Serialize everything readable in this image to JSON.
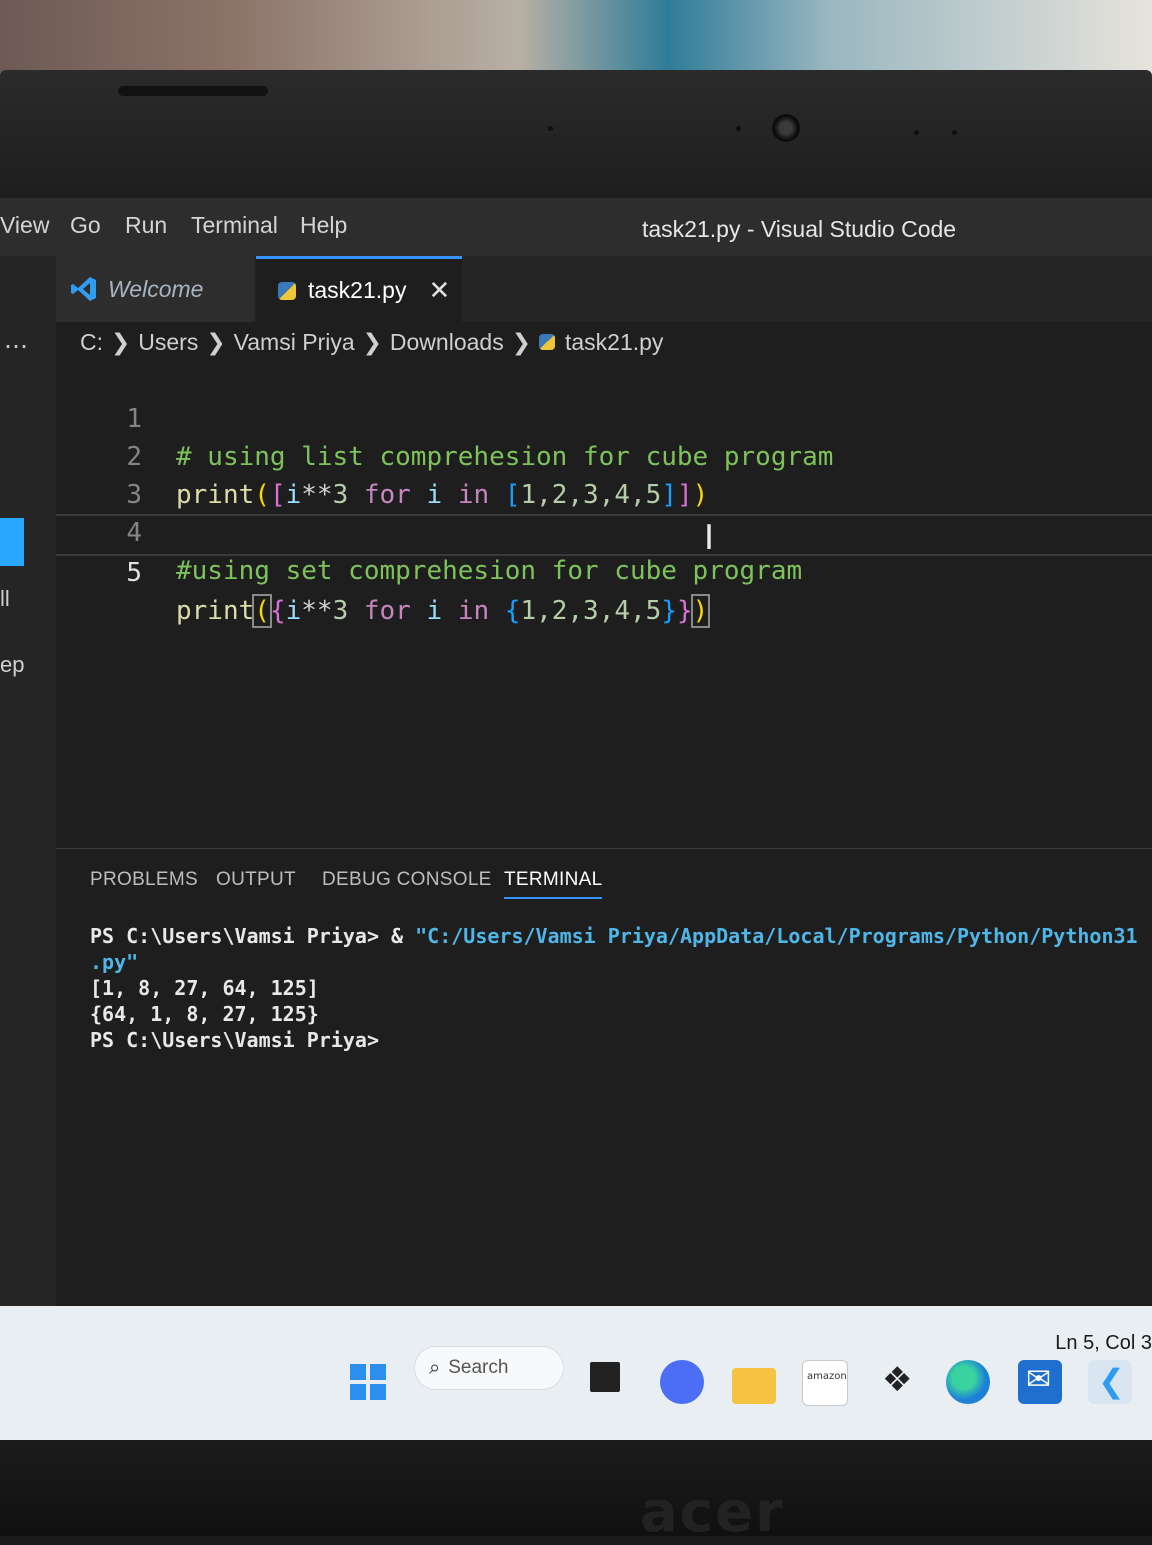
{
  "menu": {
    "view": "View",
    "go": "Go",
    "run": "Run",
    "terminal": "Terminal",
    "help": "Help"
  },
  "window_title": "task21.py - Visual Studio Code",
  "activity": {
    "ellipsis": "…",
    "frag_1": "ll",
    "frag_2": "ep"
  },
  "tabs": {
    "welcome": "Welcome",
    "active": "task21.py",
    "close": "✕"
  },
  "breadcrumb": [
    "C:",
    "Users",
    "Vamsi Priya",
    "Downloads",
    "task21.py"
  ],
  "breadcrumb_sep": "❯",
  "editor": {
    "lines": [
      {
        "n": "1",
        "comment": "# using list comprehesion for cube program"
      },
      {
        "n": "2",
        "func": "print",
        "open_paren": "(",
        "open_br": "[",
        "var": "i",
        "op": "**",
        "num": "3",
        "kw1": "for",
        "var2": "i",
        "kw2": "in",
        "inner_open": "[",
        "nums": "1,2,3,4,5",
        "inner_close": "]",
        "close_br": "]",
        "close_paren": ")"
      },
      {
        "n": "3"
      },
      {
        "n": "4",
        "comment": "#using set comprehesion for cube program"
      },
      {
        "n": "5",
        "func": "print",
        "open_paren": "(",
        "open_br": "{",
        "var": "i",
        "op": "**",
        "num": "3",
        "kw1": "for",
        "var2": "i",
        "kw2": "in",
        "inner_open": "{",
        "nums": "1,2,3,4,5",
        "inner_close": "}",
        "close_br": "}",
        "close_paren": ")"
      }
    ],
    "cursor": "I"
  },
  "panel": {
    "tabs": [
      "PROBLEMS",
      "OUTPUT",
      "DEBUG CONSOLE",
      "TERMINAL"
    ],
    "active_tab": "TERMINAL",
    "terminal": {
      "prompt1": "PS C:\\Users\\Vamsi Priya> & ",
      "path": "\"C:/Users/Vamsi Priya/AppData/Local/Programs/Python/Python31",
      "path_tail": ".py\"",
      "out1": "[1, 8, 27, 64, 125]",
      "out2": "{64, 1, 8, 27, 125}",
      "prompt2": "PS C:\\Users\\Vamsi Priya>"
    }
  },
  "status": {
    "position": "Ln 5, Col 3"
  },
  "taskbar": {
    "search_label": "Search",
    "search_glyph": "⌕",
    "amazon_label": "amazon",
    "dropbox_glyph": "❖",
    "mail_glyph": "✉",
    "vscode_glyph": "❮"
  },
  "brand": "acer",
  "colors": {
    "accent": "#3794ff",
    "comment": "#7ec25a",
    "keyword": "#c586c0",
    "function": "#dcdcaa",
    "string": "#4fb6e8"
  }
}
